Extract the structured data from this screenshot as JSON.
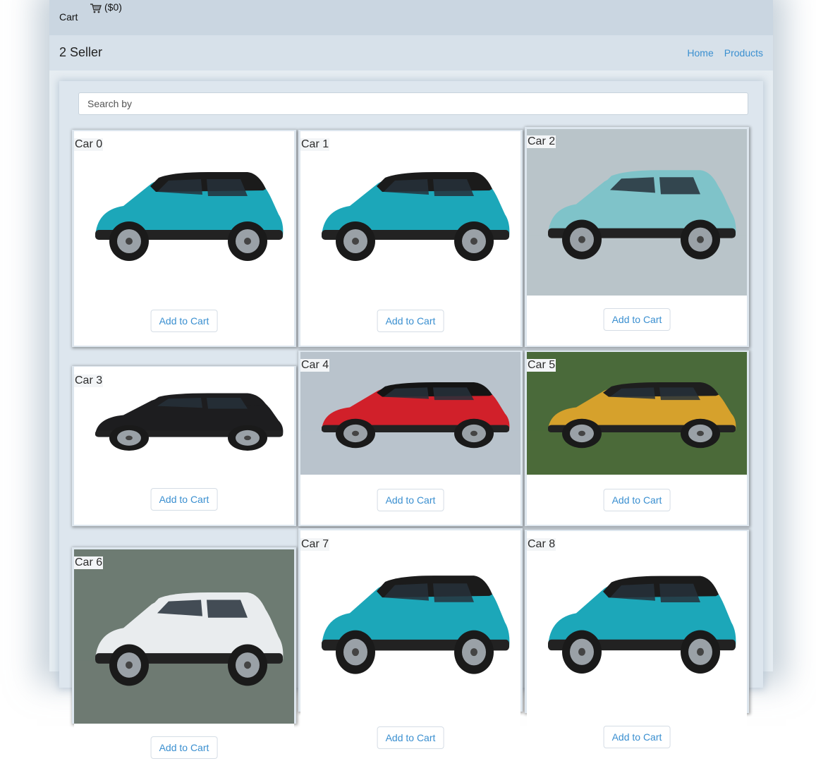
{
  "topbar": {
    "cart_label": "Cart",
    "cart_total": "($0)",
    "cart_icon": "shopping-cart-icon"
  },
  "header": {
    "brand": "2 Seller",
    "nav": {
      "home": "Home",
      "products": "Products"
    }
  },
  "search": {
    "placeholder": "Search by",
    "value": ""
  },
  "products": [
    {
      "title": "Car 0",
      "button": "Add to Cart",
      "image": "turquoise SUV side view",
      "body_color": "#1ca7b9",
      "roof_color": "#1b1b1b",
      "bg_color": "#ffffff"
    },
    {
      "title": "Car 1",
      "button": "Add to Cart",
      "image": "turquoise SUV front three-quarter view",
      "body_color": "#1ca7b9",
      "roof_color": "#1b1b1b",
      "bg_color": "#ffffff"
    },
    {
      "title": "Car 2",
      "button": "Add to Cart",
      "image": "light blue SUV on road",
      "body_color": "#7fc3c9",
      "roof_color": "#7fc3c9",
      "bg_color": "#b9c4c9"
    },
    {
      "title": "Car 3",
      "button": "Add to Cart",
      "image": "black SUV front view",
      "body_color": "#1d1d1f",
      "roof_color": "#1d1d1f",
      "bg_color": "#ffffff"
    },
    {
      "title": "Car 4",
      "button": "Add to Cart",
      "image": "red SUV with black roof",
      "body_color": "#d1202a",
      "roof_color": "#141414",
      "bg_color": "#b9c3cc"
    },
    {
      "title": "Car 5",
      "button": "Add to Cart",
      "image": "yellow SUV among pine trees",
      "body_color": "#d6a12c",
      "roof_color": "#1e1e1e",
      "bg_color": "#4b6a3a"
    },
    {
      "title": "Car 6",
      "button": "Add to Cart",
      "image": "white SUV on mountain road",
      "body_color": "#e9ecee",
      "roof_color": "#e9ecee",
      "bg_color": "#6e7b72"
    },
    {
      "title": "Car 7",
      "button": "Add to Cart",
      "image": "turquoise SUV side view",
      "body_color": "#1ca7b9",
      "roof_color": "#1b1b1b",
      "bg_color": "#ffffff"
    },
    {
      "title": "Car 8",
      "button": "Add to Cart",
      "image": "turquoise SUV front three-quarter view",
      "body_color": "#1ca7b9",
      "roof_color": "#1b1b1b",
      "bg_color": "#ffffff"
    }
  ]
}
